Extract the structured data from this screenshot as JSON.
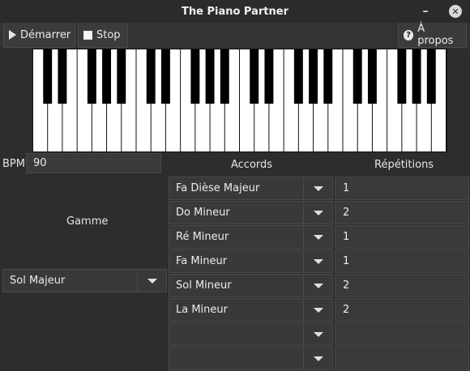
{
  "window": {
    "title": "The Piano Partner",
    "minimize": "–",
    "close": "✕"
  },
  "toolbar": {
    "start_label": "Démarrer",
    "stop_label": "Stop",
    "about_label": "À propos",
    "about_icon": "?"
  },
  "bpm": {
    "label": "BPM",
    "value": "90"
  },
  "headers": {
    "chords": "Accords",
    "repetitions": "Répétitions"
  },
  "scale": {
    "label": "Gamme",
    "value": "Sol Majeur"
  },
  "rows": [
    {
      "chord": "Fa Dièse Majeur",
      "reps": "1"
    },
    {
      "chord": "Do Mineur",
      "reps": "2"
    },
    {
      "chord": "Ré Mineur",
      "reps": "1"
    },
    {
      "chord": "Fa Mineur",
      "reps": "1"
    },
    {
      "chord": "Sol Mineur",
      "reps": "2"
    },
    {
      "chord": "La Mineur",
      "reps": "2"
    },
    {
      "chord": "",
      "reps": ""
    },
    {
      "chord": "",
      "reps": ""
    }
  ],
  "colors": {
    "background": "#2d2d2d",
    "field": "#3a3a3a",
    "white_key": "#ffffff",
    "black_key": "#000000"
  }
}
